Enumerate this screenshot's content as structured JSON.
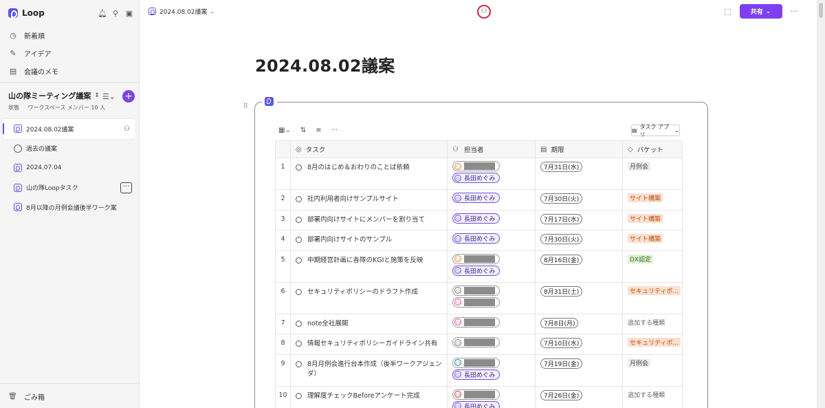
{
  "app": {
    "name": "Loop",
    "header_icons": [
      "bell-icon",
      "search-icon",
      "sidebar-toggle-icon"
    ]
  },
  "nav": [
    {
      "label": "新着順",
      "icon": "clock-icon"
    },
    {
      "label": "アイデア",
      "icon": "pen-icon"
    },
    {
      "label": "会議のメモ",
      "icon": "note-icon"
    }
  ],
  "workspace": {
    "title": "山の隊ミーティング議案",
    "status_label": "状態",
    "members": "ワークスペース メンバー 10 人"
  },
  "pages": [
    {
      "label": "2024.08.02議案",
      "icon": "loop-page-icon",
      "active": true
    },
    {
      "label": "過去の議案",
      "icon": "globe-icon"
    },
    {
      "label": "2024.07.04",
      "icon": "loop-page-icon"
    },
    {
      "label": "山の隊Loopタスク",
      "icon": "loop-page-icon"
    },
    {
      "label": "8月以降の月例会議後半ワーク案",
      "icon": "loop-page-icon"
    }
  ],
  "trash": {
    "label": "ごみ箱"
  },
  "topbar": {
    "breadcrumb": "2024.08.02議案",
    "share_label": "共有"
  },
  "document": {
    "title": "2024.08.02議案"
  },
  "component": {
    "app_button_label": "タスク アプリ"
  },
  "table": {
    "headers": {
      "task": "タスク",
      "owner": "担当者",
      "due": "期限",
      "bucket": "バケット"
    },
    "rows": [
      {
        "num": "1",
        "task": "8月のはじめ＆おわりのことば依頼",
        "owners": [
          {
            "type": "redacted",
            "color": "o"
          },
          {
            "type": "named",
            "name": "長田めぐみ"
          }
        ],
        "due": "7月31日(水)",
        "bucket": "月例会",
        "bucket_style": "gray"
      },
      {
        "num": "2",
        "task": "社内利用者向けサンプルサイト",
        "owners": [
          {
            "type": "named",
            "name": "長田めぐみ"
          }
        ],
        "due": "7月30日(火)",
        "bucket": "サイト構築",
        "bucket_style": "orange"
      },
      {
        "num": "3",
        "task": "部署内向けサイトにメンバーを割り当て",
        "owners": [
          {
            "type": "named",
            "name": "長田めぐみ"
          }
        ],
        "due": "7月17日(水)",
        "bucket": "サイト構築",
        "bucket_style": "orange"
      },
      {
        "num": "4",
        "task": "部署内向けサイトのサンプル",
        "owners": [
          {
            "type": "named",
            "name": "長田めぐみ"
          }
        ],
        "due": "7月30日(火)",
        "bucket": "サイト構築",
        "bucket_style": "orange"
      },
      {
        "num": "5",
        "task": "中期経営計画に各隊のKGIと施策を反映",
        "owners": [
          {
            "type": "redacted",
            "color": "o"
          },
          {
            "type": "named",
            "name": "長田めぐみ"
          }
        ],
        "due": "8月16日(金)",
        "bucket": "DX認定",
        "bucket_style": "green"
      },
      {
        "num": "6",
        "task": "セキュリティポリシーのドラフト作成",
        "owners": [
          {
            "type": "redacted",
            "color": "g"
          },
          {
            "type": "redacted",
            "color": "p"
          }
        ],
        "due": "8月31日(土)",
        "bucket": "セキュリティポ...",
        "bucket_style": "orange"
      },
      {
        "num": "7",
        "task": "note全社展開",
        "owners": [
          {
            "type": "redacted",
            "color": "p"
          }
        ],
        "due": "7月8日(月)",
        "bucket": "追加する種類",
        "bucket_style": "none"
      },
      {
        "num": "8",
        "task": "情報セキュリティポリシーガイドライン共有",
        "owners": [
          {
            "type": "redacted",
            "color": "g"
          }
        ],
        "due": "7月10日(水)",
        "bucket": "セキュリティポ...",
        "bucket_style": "orange"
      },
      {
        "num": "9",
        "task": "8月月例会進行台本作成（後半ワークアジェンダ）",
        "owners": [
          {
            "type": "redacted",
            "color": "t"
          },
          {
            "type": "named",
            "name": "長田めぐみ"
          }
        ],
        "due": "7月19日(金)",
        "bucket": "月例会",
        "bucket_style": "gray"
      },
      {
        "num": "10",
        "task": "理解度チェックBeforeアンケート完成",
        "owners": [
          {
            "type": "redacted",
            "color": "r"
          },
          {
            "type": "named",
            "name": "長田めぐみ"
          }
        ],
        "due": "7月26日(金)",
        "bucket": "追加する種類",
        "bucket_style": "none"
      }
    ]
  }
}
